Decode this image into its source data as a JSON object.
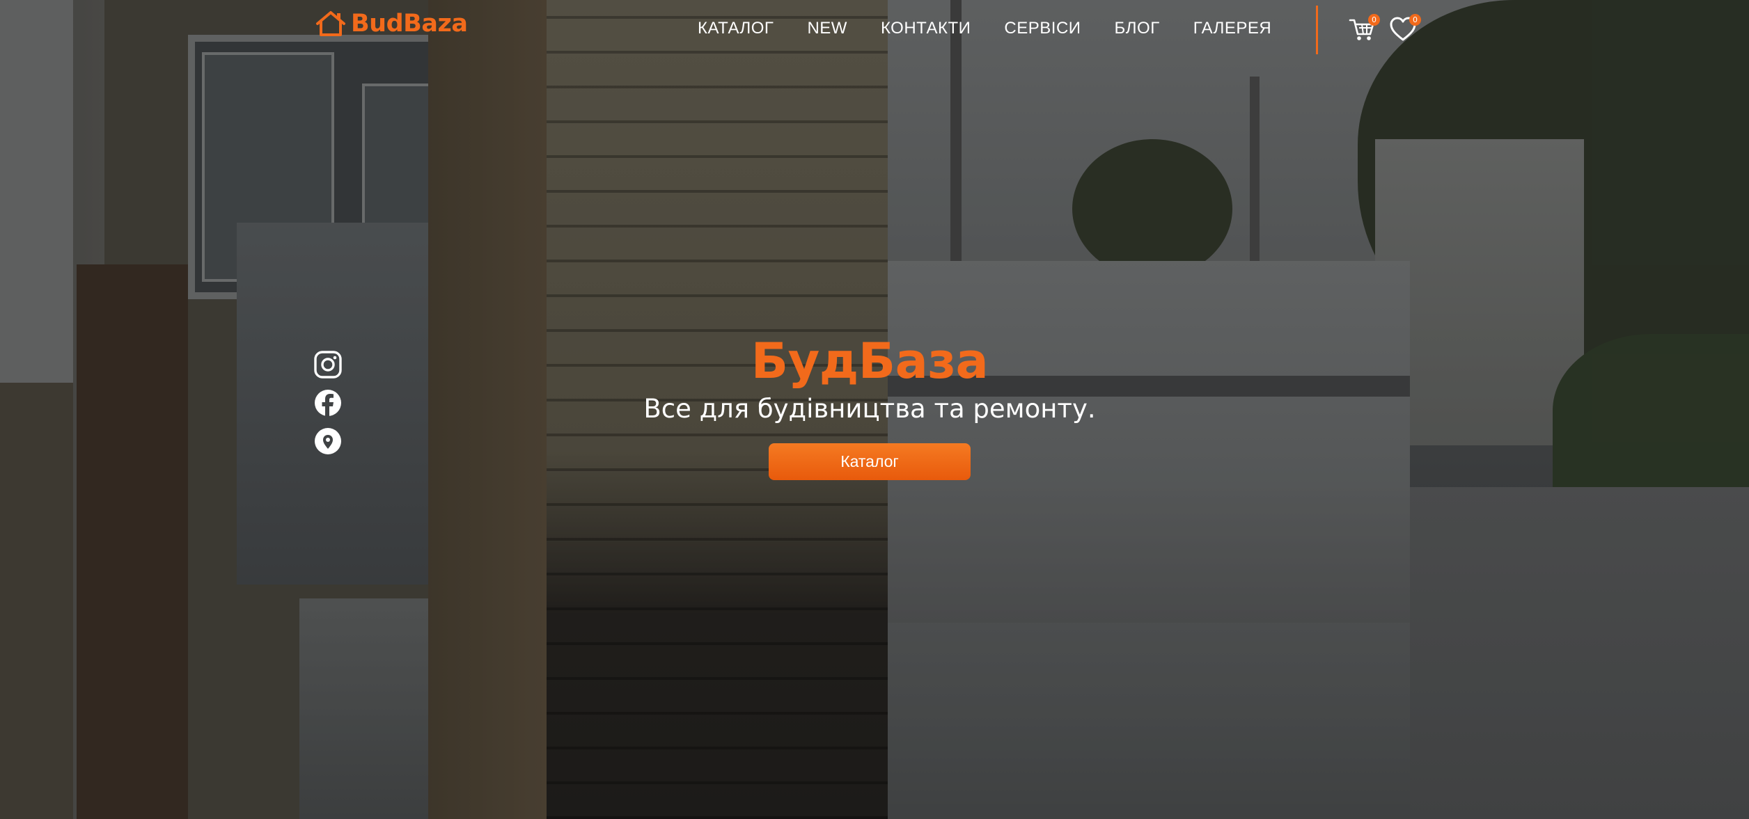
{
  "header": {
    "logo_text": "BudBaza",
    "nav": [
      "КАТАЛОГ",
      "NEW",
      "КОНТАКТИ",
      "СЕРВІСИ",
      "БЛОГ",
      "ГАЛЕРЕЯ"
    ],
    "cart_count": "0",
    "favorites_count": "0"
  },
  "hero": {
    "title": "БудБаза",
    "subtitle": "Все для будівництва та ремонту.",
    "button_label": "Каталог"
  },
  "social": {
    "icons": [
      "instagram-icon",
      "facebook-icon",
      "location-pin-icon"
    ]
  },
  "colors": {
    "accent": "#f26a1b",
    "text_light": "#ffffff"
  }
}
